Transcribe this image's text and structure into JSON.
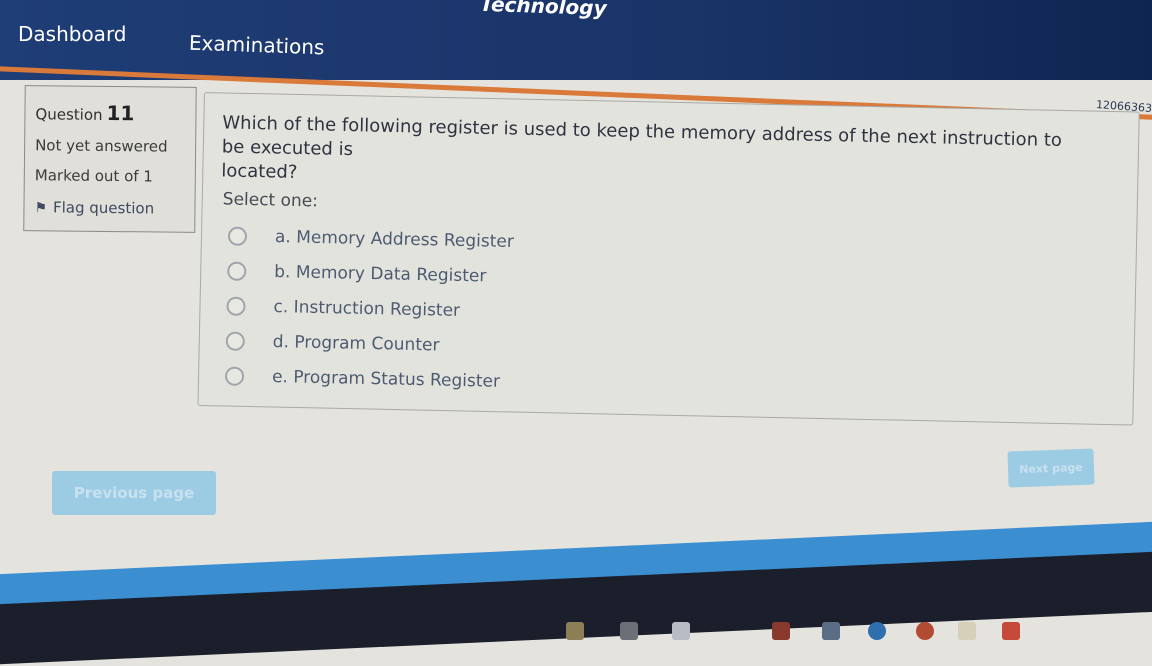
{
  "header": {
    "site_title": "Technology",
    "nav": [
      "Dashboard",
      "Examinations"
    ],
    "user_id": "12066363"
  },
  "info": {
    "question_label": "Question",
    "question_number": "11",
    "status": "Not yet answered",
    "marks": "Marked out of 1",
    "flag_label": "Flag question"
  },
  "question": {
    "text_main": "Which of the following register is used to keep the memory address of the next instruction to be executed is",
    "text_cont": "located?",
    "select_label": "Select one:",
    "options": [
      "a. Memory Address Register",
      "b. Memory Data Register",
      "c. Instruction Register",
      "d. Program Counter",
      "e. Program Status Register"
    ]
  },
  "buttons": {
    "previous": "Previous page",
    "next": "Next page"
  },
  "colors": {
    "header": "#1f3d76",
    "accent_orange": "#d9793a",
    "button": "#9ccbe4",
    "footer_blue": "#3b8ed0"
  }
}
